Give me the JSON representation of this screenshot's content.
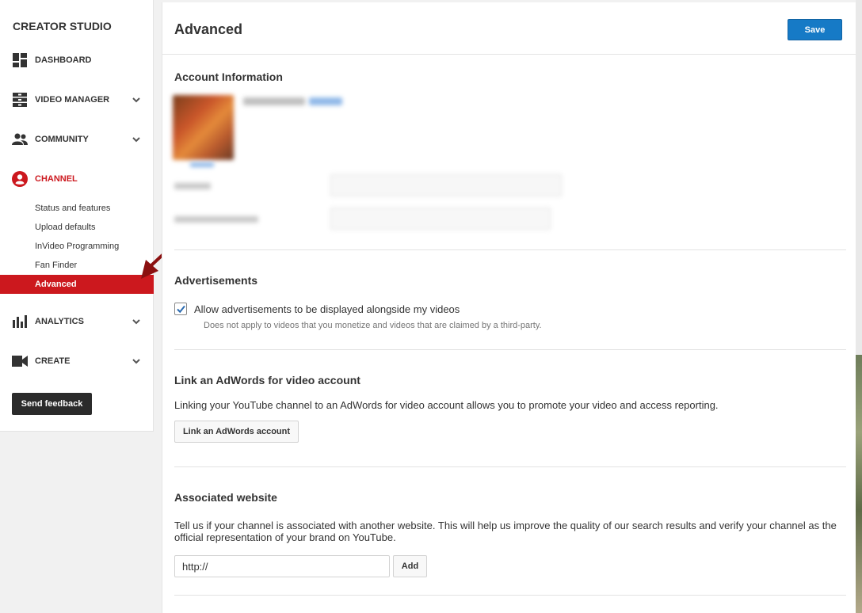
{
  "sidebar": {
    "brand": "CREATOR STUDIO",
    "items": [
      {
        "label": "DASHBOARD",
        "icon": "dashboard-icon"
      },
      {
        "label": "VIDEO MANAGER",
        "icon": "video-manager-icon"
      },
      {
        "label": "COMMUNITY",
        "icon": "community-icon"
      },
      {
        "label": "CHANNEL",
        "icon": "channel-icon"
      },
      {
        "label": "ANALYTICS",
        "icon": "analytics-icon"
      },
      {
        "label": "CREATE",
        "icon": "create-icon"
      }
    ],
    "channel_subitems": [
      "Status and features",
      "Upload defaults",
      "InVideo Programming",
      "Fan Finder",
      "Advanced"
    ],
    "selected_subitem": "Advanced",
    "feedback_label": "Send feedback"
  },
  "header": {
    "title": "Advanced",
    "save_label": "Save"
  },
  "account": {
    "title": "Account Information"
  },
  "ads": {
    "title": "Advertisements",
    "checkbox_label": "Allow advertisements to be displayed alongside my videos",
    "checked": true,
    "note": "Does not apply to videos that you monetize and videos that are claimed by a third-party."
  },
  "adwords": {
    "title": "Link an AdWords for video account",
    "description": "Linking your YouTube channel to an AdWords for video account allows you to promote your video and access reporting.",
    "button_label": "Link an AdWords account"
  },
  "website": {
    "title": "Associated website",
    "description_line1": "Tell us if your channel is associated with another website. This will help us improve the quality of our search results and verify your channel as the",
    "description_line2": "official representation of your brand on YouTube.",
    "input_value": "http://",
    "add_label": "Add"
  },
  "colors": {
    "accent_red": "#cc181e",
    "save_blue": "#167ac6"
  }
}
